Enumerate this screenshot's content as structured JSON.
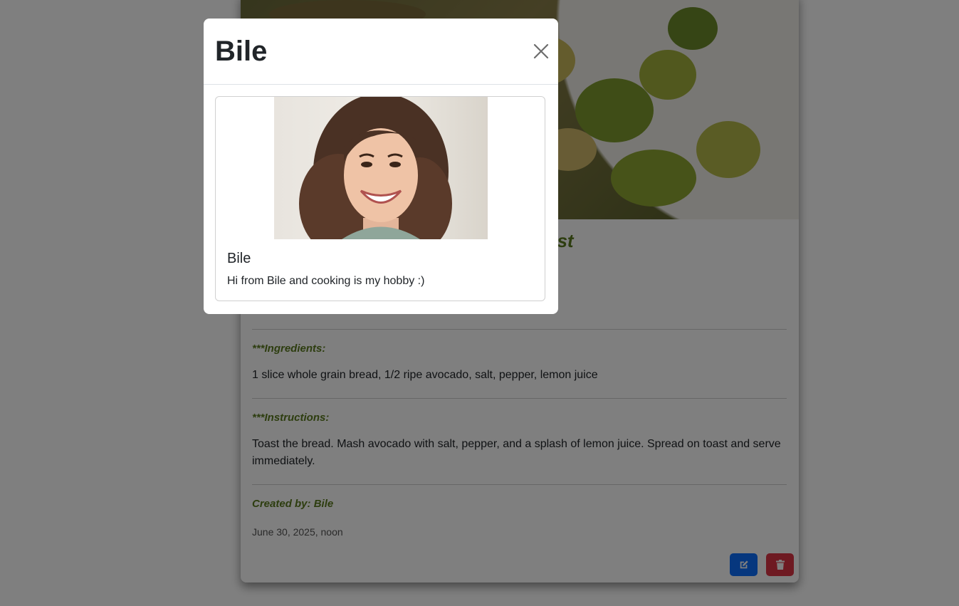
{
  "recipe": {
    "title_visible": "ast",
    "ingredients_label": "***Ingredients:",
    "ingredients": "1 slice whole grain bread, 1/2 ripe avocado, salt, pepper, lemon juice",
    "instructions_label": "***Instructions:",
    "instructions": "Toast the bread. Mash avocado with salt, pepper, and a splash of lemon juice. Spread on toast and serve immediately.",
    "created_by": "Created by: Bile",
    "date": "June 30, 2025, noon",
    "edit_icon": "edit-icon",
    "delete_icon": "trash-icon"
  },
  "modal": {
    "title": "Bile",
    "close_icon": "close-icon",
    "profile": {
      "name": "Bile",
      "bio": "Hi from Bile and cooking is my hobby :)"
    }
  },
  "colors": {
    "accent_green": "#5a7a1e",
    "edit_blue": "#0d6efd",
    "delete_red": "#dc3545"
  }
}
